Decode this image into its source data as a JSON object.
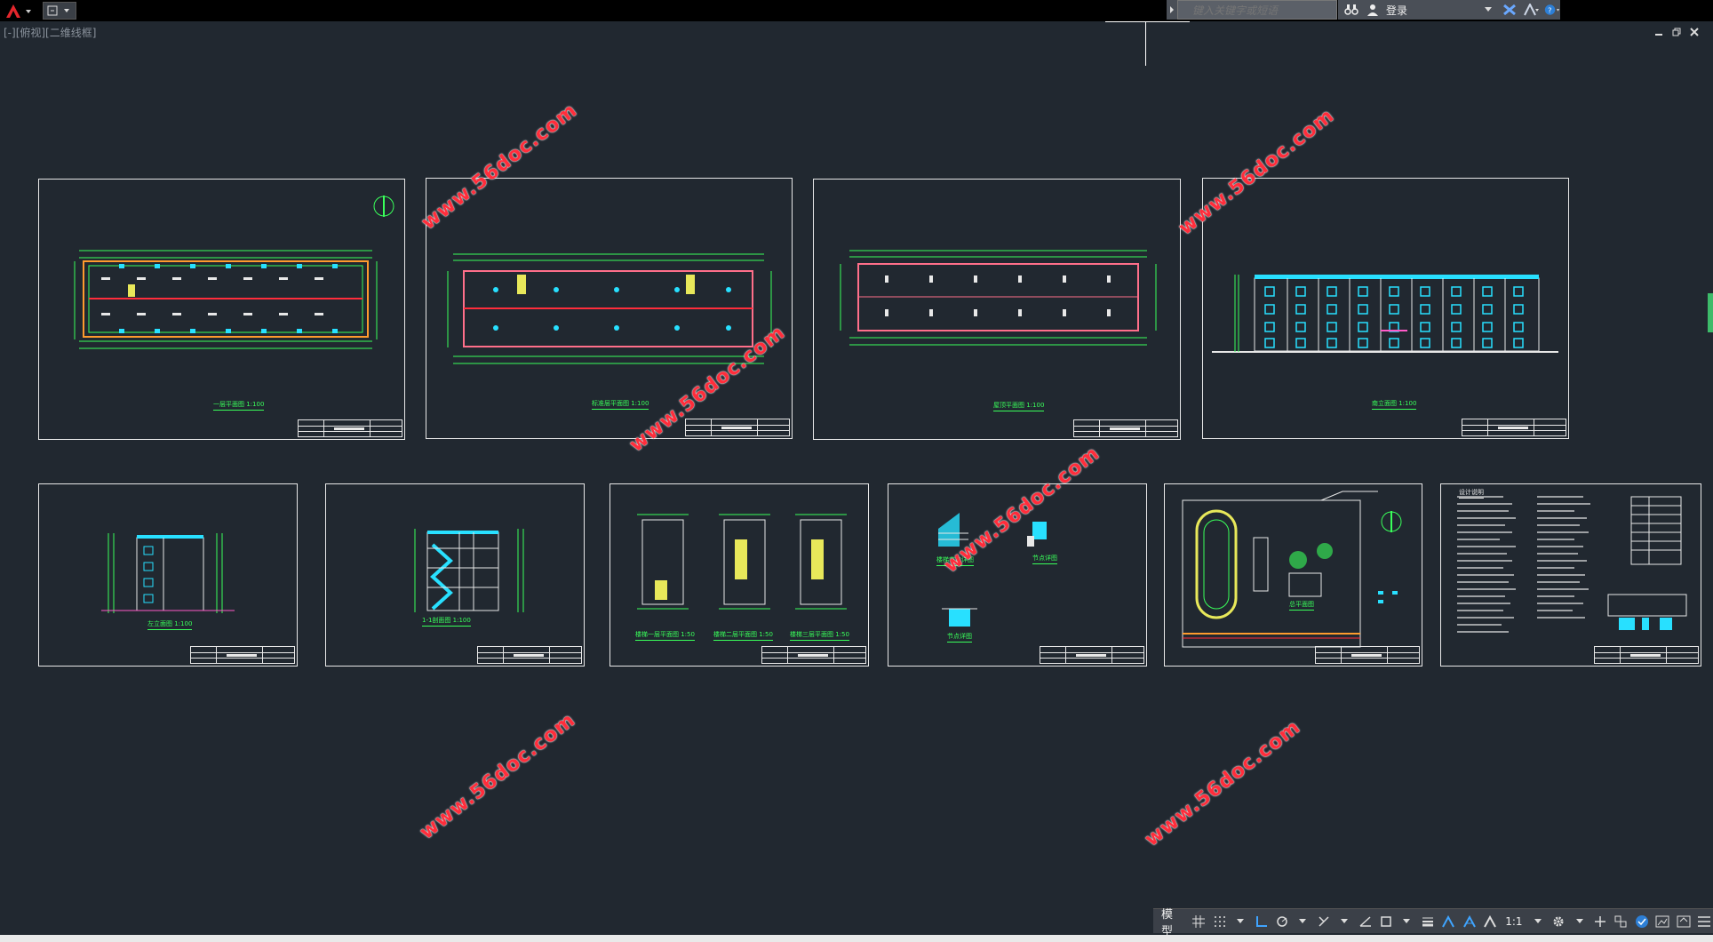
{
  "toolbar": {
    "app_menu_icon": "autocad-a-icon",
    "quick_access_icon": "workspace-icon",
    "search": {
      "placeholder": "键入关键字或短语"
    },
    "login_label": "登录"
  },
  "viewport": {
    "label": "[-][俯视][二维线框]"
  },
  "sheets": [
    {
      "caption": "一层平面图 1:100"
    },
    {
      "caption": "标准层平面图 1:100"
    },
    {
      "caption": "屋顶平面图 1:100"
    },
    {
      "caption": "南立面图 1:100"
    },
    {
      "caption": "左立面图 1:100"
    },
    {
      "caption": "1-1剖面图 1:100"
    },
    {
      "captions": [
        "楼梯一层平面图 1:50",
        "楼梯二层平面图 1:50",
        "楼梯三层平面图 1:50"
      ]
    },
    {
      "captions": [
        "楼梯节点详图",
        "节点详图",
        "节点详图"
      ]
    },
    {
      "caption": "总平面图"
    },
    {
      "caption": "设计说明"
    }
  ],
  "watermarks": [
    "www.56doc.com",
    "www.56doc.com",
    "www.56doc.com",
    "www.56doc.com",
    "www.56doc.com",
    "www.56doc.com",
    "www.56doc.com"
  ],
  "statusbar": {
    "model_label": "模型",
    "scale_label": "1:1"
  },
  "colors": {
    "background": "#212830",
    "sheet_border": "#e8e8e8",
    "watermark": "#ff2d3b",
    "drawing_green": "#39ff5a",
    "drawing_cyan": "#28e0ff"
  }
}
